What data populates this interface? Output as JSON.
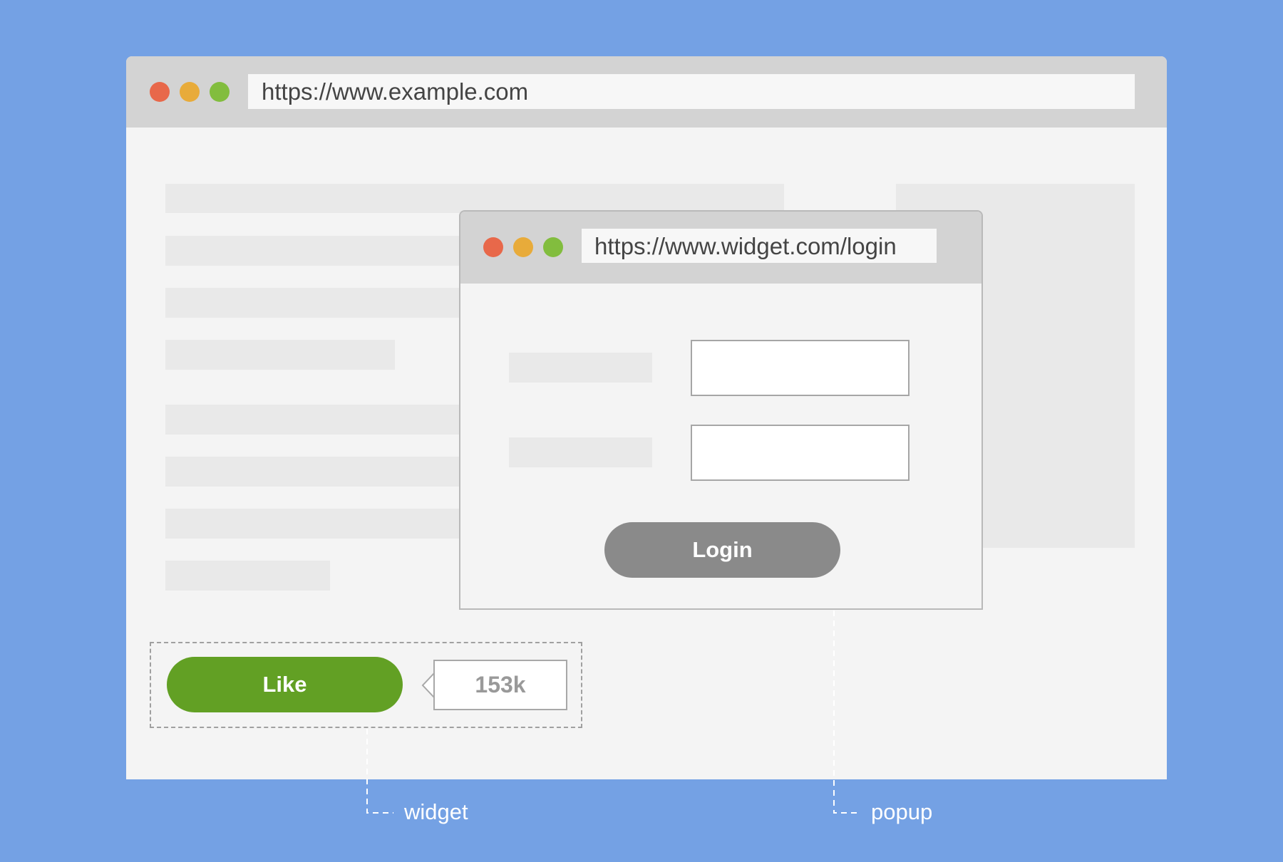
{
  "main_window": {
    "url": "https://www.example.com",
    "window_controls": [
      "close",
      "minimize",
      "maximize"
    ]
  },
  "popup": {
    "url": "https://www.widget.com/login",
    "login_label": "Login",
    "fields": [
      {
        "value": ""
      },
      {
        "value": ""
      }
    ]
  },
  "widget": {
    "like_label": "Like",
    "like_count": "153k"
  },
  "annotations": {
    "widget_label": "widget",
    "popup_label": "popup"
  },
  "colors": {
    "background": "#74a1e4",
    "like_button": "#62a024",
    "login_button": "#8a8a8a",
    "close_dot": "#e8684a",
    "minimize_dot": "#e8ab3a",
    "maximize_dot": "#82bd3e"
  }
}
